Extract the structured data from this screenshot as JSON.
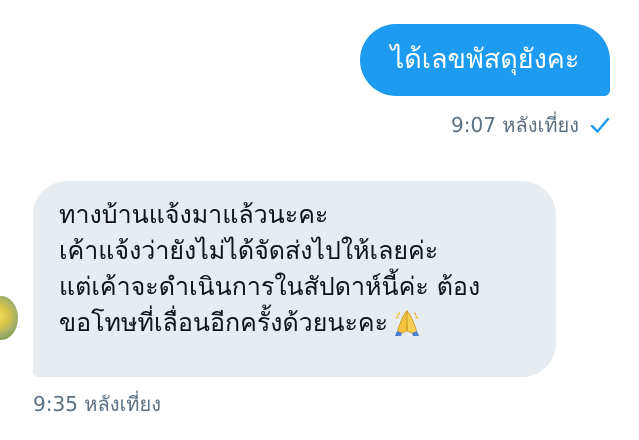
{
  "outgoing_message": {
    "text": "ได้เลขพัสดุยังคะ",
    "time": "9:07 หลังเที่ยง",
    "status_icon": "check-icon",
    "bubble_color": "#1d9bf0"
  },
  "incoming_message": {
    "lines": [
      "ทางบ้านแจ้งมาแล้วนะคะ",
      "เค้าแจ้งว่ายังไม่ได้จัดส่งไปให้เลยค่ะ",
      "แต่เค้าจะดำเนินการในสัปดาห์นี้ค่ะ ต้อง",
      "ขอโทษที่เลื่อนอีกครั้งด้วยนะคะ"
    ],
    "emoji": "folded-hands-icon",
    "time": "9:35 หลังเที่ยง",
    "bubble_color": "#e7ecf0"
  },
  "colors": {
    "accent": "#1d9bf0",
    "timestamp": "#5b7083",
    "text": "#0f1419"
  }
}
